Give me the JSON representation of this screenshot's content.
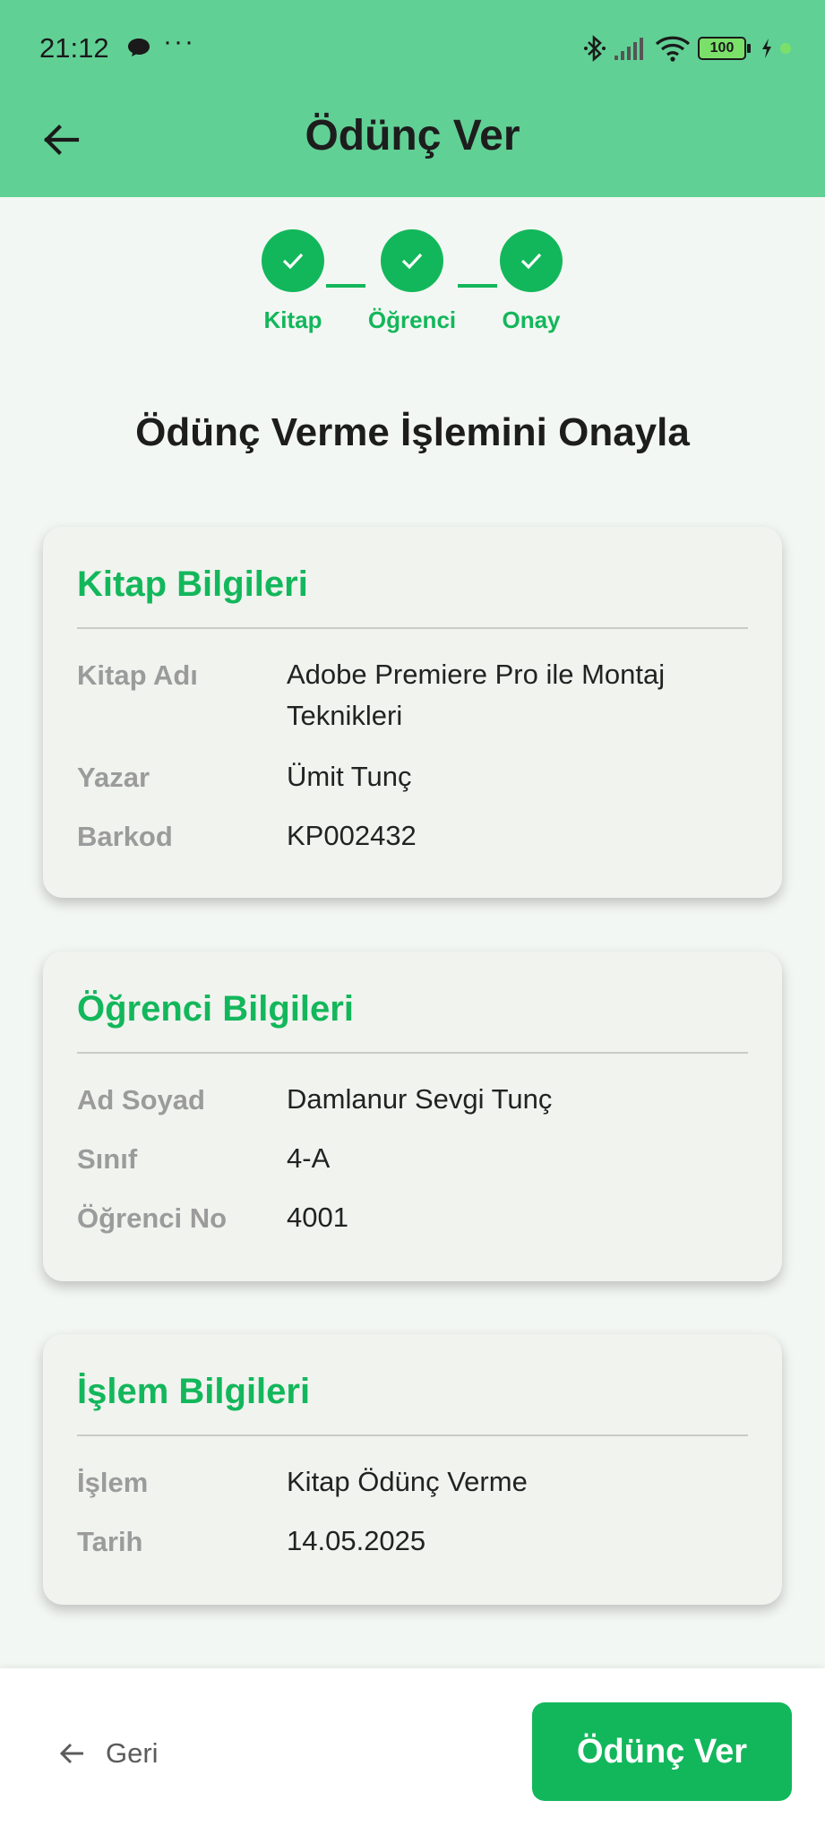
{
  "status_bar": {
    "time": "21:12",
    "dots": "···",
    "battery": "100"
  },
  "header": {
    "title": "Ödünç Ver"
  },
  "stepper": {
    "steps": [
      {
        "label": "Kitap",
        "done": true
      },
      {
        "label": "Öğrenci",
        "done": true
      },
      {
        "label": "Onay",
        "done": true
      }
    ]
  },
  "main": {
    "heading": "Ödünç Verme İşlemini Onayla"
  },
  "cards": {
    "book": {
      "title": "Kitap Bilgileri",
      "rows": [
        {
          "label": "Kitap Adı",
          "value": "Adobe Premiere Pro ile Montaj Teknikleri"
        },
        {
          "label": "Yazar",
          "value": "Ümit Tunç"
        },
        {
          "label": "Barkod",
          "value": "KP002432"
        }
      ]
    },
    "student": {
      "title": "Öğrenci Bilgileri",
      "rows": [
        {
          "label": "Ad Soyad",
          "value": "Damlanur Sevgi Tunç"
        },
        {
          "label": "Sınıf",
          "value": "4-A"
        },
        {
          "label": "Öğrenci No",
          "value": "4001"
        }
      ]
    },
    "transaction": {
      "title": "İşlem Bilgileri",
      "rows": [
        {
          "label": "İşlem",
          "value": "Kitap Ödünç Verme"
        },
        {
          "label": "Tarih",
          "value": "14.05.2025"
        }
      ]
    }
  },
  "footer": {
    "back_label": "Geri",
    "submit_label": "Ödünç Ver"
  },
  "colors": {
    "header": "#61d095",
    "accent": "#13b75b",
    "background": "#f3f7f3"
  },
  "icons": {
    "back": "arrow-left-icon",
    "step": "check-icon"
  }
}
